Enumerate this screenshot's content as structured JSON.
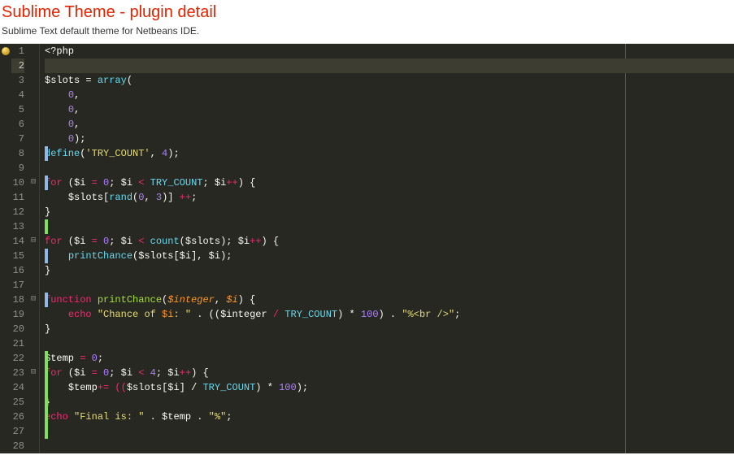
{
  "header": {
    "title": "Sublime Theme - plugin detail",
    "subtitle": "Sublime Text default theme for Netbeans IDE."
  },
  "editor": {
    "active_line": 2,
    "total_lines": 28,
    "fold_markers": {
      "10": "⊟",
      "14": "⊟",
      "18": "⊟",
      "23": "⊟"
    },
    "markers": [
      {
        "line": 8,
        "color": "blue"
      },
      {
        "line": 10,
        "color": "blue"
      },
      {
        "line": 13,
        "color": "green"
      },
      {
        "line": 15,
        "color": "blue"
      },
      {
        "line": 18,
        "color": "blue"
      },
      {
        "line": 22,
        "color": "green"
      },
      {
        "line": 23,
        "color": "green"
      },
      {
        "line": 24,
        "color": "green"
      },
      {
        "line": 25,
        "color": "green"
      },
      {
        "line": 26,
        "color": "green"
      },
      {
        "line": 27,
        "color": "green"
      }
    ],
    "code": {
      "l1": {
        "phptag": "<?php"
      },
      "l3": {
        "var": "$slots",
        "eq": " = ",
        "fn": "array",
        "open": "("
      },
      "l4": {
        "num": "0",
        "comma": ","
      },
      "l5": {
        "num": "0",
        "comma": ","
      },
      "l6": {
        "num": "0",
        "comma": ","
      },
      "l7": {
        "num": "0",
        "close": ");"
      },
      "l8": {
        "fn": "define",
        "open": "(",
        "str": "'TRY_COUNT'",
        "comma": ", ",
        "num": "4",
        "close": ");"
      },
      "l10": {
        "kw": "for",
        "open": " (",
        "var": "$i",
        "eq": " = ",
        "num0": "0",
        "sep": "; ",
        "var2": "$i",
        "lt": " < ",
        "const": "TRY_COUNT",
        "sep2": "; ",
        "var3": "$i",
        "inc": "++",
        "close": ") {"
      },
      "l11": {
        "var": "$slots",
        "b1": "[",
        "fn": "rand",
        "open": "(",
        "num0": "0",
        "comma": ", ",
        "num1": "3",
        "close": ")] ",
        "inc": "++",
        "semi": ";"
      },
      "l12": {
        "brace": "}"
      },
      "l14": {
        "kw": "for",
        "open": " (",
        "var": "$i",
        "eq": " = ",
        "num0": "0",
        "sep": "; ",
        "var2": "$i",
        "lt": " < ",
        "fn": "count",
        "p1": "(",
        "var3": "$slots",
        "p2": "); ",
        "var4": "$i",
        "inc": "++",
        "close": ") {"
      },
      "l15": {
        "fn": "printChance",
        "open": "(",
        "var": "$slots",
        "b1": "[",
        "var2": "$i",
        "b2": "], ",
        "var3": "$i",
        "close": ");"
      },
      "l16": {
        "brace": "}"
      },
      "l18": {
        "kw": "function",
        "sp": " ",
        "fn": "printChance",
        "open": "(",
        "p1": "$integer",
        "comma": ", ",
        "p2": "$i",
        "close": ") {"
      },
      "l19": {
        "kw": "echo",
        "sp": " ",
        "str1": "\"Chance of ",
        "var1": "$i",
        "str2": ": \"",
        "dot1": " . ((",
        "var2": "$integer",
        "div": " / ",
        "const": "TRY_COUNT",
        "mul": ") * ",
        "num": "100",
        "close": ") . ",
        "str3": "\"%<br />\"",
        "semi": ";"
      },
      "l20": {
        "brace": "}"
      },
      "l22": {
        "var": "$temp",
        "eq": " = ",
        "num": "0",
        "semi": ";"
      },
      "l23": {
        "kw": "for",
        "open": " (",
        "var": "$i",
        "eq": " = ",
        "num0": "0",
        "sep": "; ",
        "var2": "$i",
        "lt": " < ",
        "num1": "4",
        "sep2": "; ",
        "var3": "$i",
        "inc": "++",
        "close": ") {"
      },
      "l24": {
        "var": "$temp",
        "op": "+= ((",
        "var2": "$slots",
        "b1": "[",
        "var3": "$i",
        "b2": "] / ",
        "const": "TRY_COUNT",
        "mul": ") * ",
        "num": "100",
        "close": ");"
      },
      "l25": {
        "brace": "}"
      },
      "l26": {
        "kw": "echo",
        "sp": " ",
        "str1": "\"Final is: \"",
        "dot": " . ",
        "var": "$temp",
        "dot2": " . ",
        "str2": "\"%\"",
        "semi": ";"
      }
    }
  }
}
